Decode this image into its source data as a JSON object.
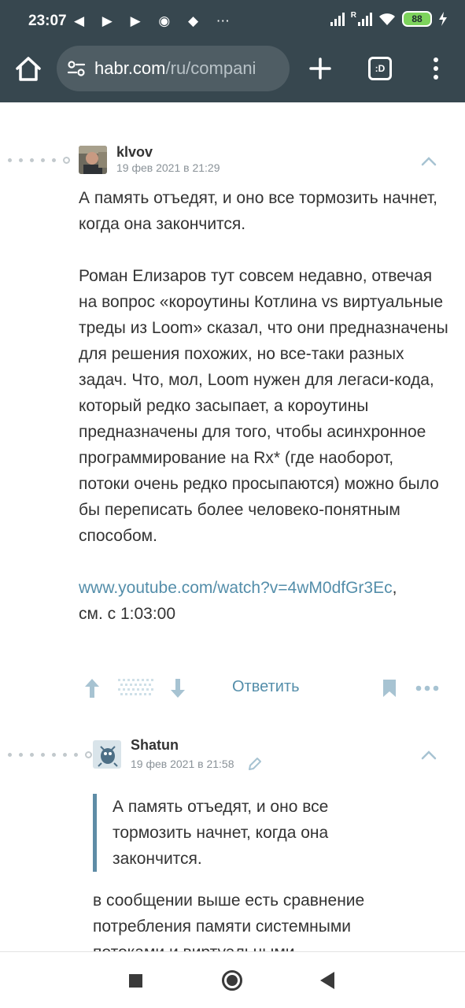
{
  "status_bar": {
    "time": "23:07",
    "notification_icons": [
      "volume-icon",
      "play-icon",
      "play-icon",
      "whatsapp-icon",
      "dropbox-icon",
      "more-notifications-icon"
    ],
    "notification_glyphs": "◀ ▶ ▶ ◉ ◆ ⋯",
    "roaming_mark": "R",
    "battery_level": "88"
  },
  "browser": {
    "url_domain": "habr.com",
    "url_path": "/ru/compani",
    "tabs_label": ":D"
  },
  "comments": [
    {
      "author": "klvov",
      "date": "19 фев 2021 в 21:29",
      "paragraphs": [
        "А память отъедят, и оно все тормозить начнет, когда она закончится.",
        "Роман Елизаров тут совсем недавно, отвечая на вопрос «короутины Котлина vs виртуальные треды из Loom» сказал, что они предназначены для решения похожих, но все-таки разных задач. Что, мол, Loom нужен для легаси-кода, который редко засыпает, а короутины предназначены для того, чтобы асинхронное программирование на Rx* (где наоборот, потоки очень редко просыпаются) можно было бы переписать более человеко-понятным способом."
      ],
      "link_text": "www.youtube.com/watch?v=4wM0dfGr3Ec",
      "link_suffix": ",",
      "after_link": "см. с 1:03:00",
      "reply_label": "Ответить"
    },
    {
      "author": "Shatun",
      "date": "19 фев 2021 в 21:58",
      "quote": "А память отъедят, и оно все тормозить начнет, когда она закончится.",
      "body_visible": "в сообщении выше есть сравнение потребления памяти системными потоками и виртуальными"
    }
  ],
  "colors": {
    "chrome_bg": "#37474f",
    "link": "#548eaa",
    "quote_bar": "#5e8ca6",
    "battery": "#7dd35c"
  }
}
